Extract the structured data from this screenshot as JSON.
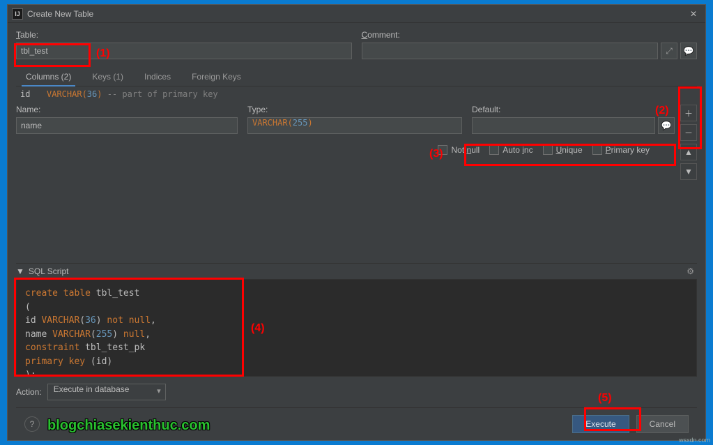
{
  "window": {
    "title": "Create New Table"
  },
  "labels": {
    "table": "Table:",
    "comment": "Comment:",
    "name": "Name:",
    "type": "Type:",
    "default": "Default:",
    "action": "Action:",
    "sqlscript": "SQL Script"
  },
  "table_name": "tbl_test",
  "comment_value": "",
  "tabs": {
    "columns": "Columns (2)",
    "keys": "Keys (1)",
    "indices": "Indices",
    "foreign": "Foreign Keys"
  },
  "col_preview": {
    "id": "id",
    "type_kw": "VARCHAR(",
    "type_num": "36",
    "type_close": ")",
    "note": " -- part of primary key"
  },
  "field": {
    "name_value": "name",
    "type_kw": "VARCHAR(",
    "type_num": "255",
    "type_close": ")",
    "default_value": ""
  },
  "checks": {
    "notnull": "Not null",
    "autoinc": "Auto inc",
    "unique": "Unique",
    "primary": "Primary key"
  },
  "sql": {
    "l1a": "create table",
    "l1b": " tbl_test",
    "l2": "(",
    "l3a": "    id ",
    "l3b": "VARCHAR",
    "l3c": "(",
    "l3d": "36",
    "l3e": ") ",
    "l3f": "not null",
    "l3g": ",",
    "l4a": "    name ",
    "l4b": "VARCHAR",
    "l4c": "(",
    "l4d": "255",
    "l4e": ") ",
    "l4f": "null",
    "l4g": ",",
    "l5a": "    ",
    "l5b": "constraint",
    "l5c": " tbl_test_pk",
    "l6a": "        ",
    "l6b": "primary key",
    "l6c": " (id)",
    "l7": ");"
  },
  "action_select": "Execute in database",
  "buttons": {
    "execute": "Execute",
    "cancel": "Cancel",
    "help": "?"
  },
  "annotations": {
    "a1": "(1)",
    "a2": "(2)",
    "a3": "(3)",
    "a4": "(4)",
    "a5": "(5)"
  },
  "watermark": "blogchiasekienthuc.com",
  "wsx": "wsxdn.com"
}
